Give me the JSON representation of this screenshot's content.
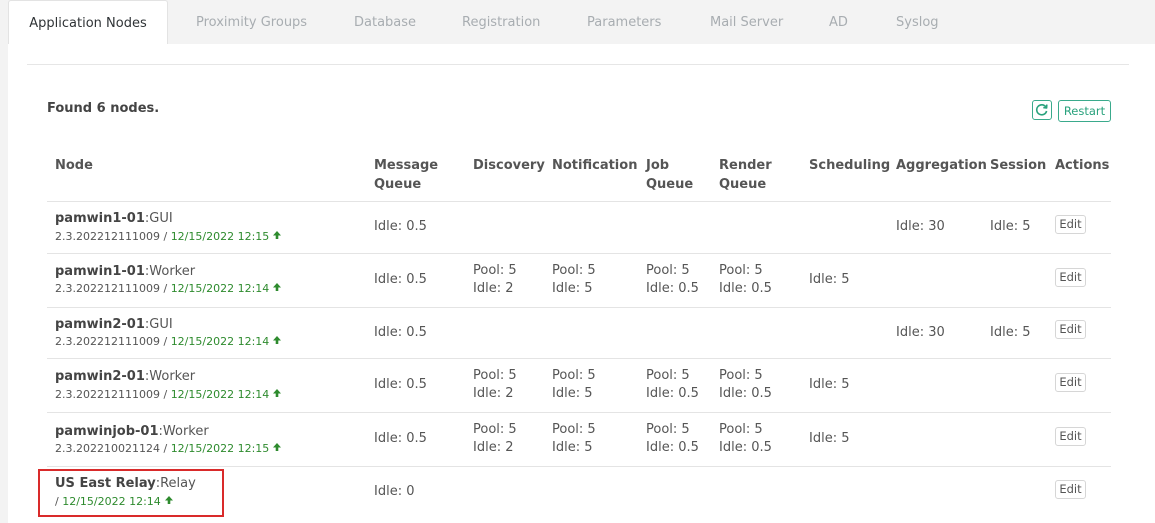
{
  "tabs": [
    {
      "label": "Application Nodes",
      "active": true
    },
    {
      "label": "Proximity Groups"
    },
    {
      "label": "Database"
    },
    {
      "label": "Registration"
    },
    {
      "label": "Parameters"
    },
    {
      "label": "Mail Server"
    },
    {
      "label": "AD"
    },
    {
      "label": "Syslog"
    }
  ],
  "summary": {
    "found_text": "Found 6 nodes."
  },
  "toolbar": {
    "refresh_icon": "refresh-icon",
    "restart_label": "Restart"
  },
  "table": {
    "headers": {
      "node": "Node",
      "message_queue_1": "Message",
      "message_queue_2": "Queue",
      "discovery": "Discovery",
      "notification": "Notification",
      "job_queue_1": "Job",
      "job_queue_2": "Queue",
      "render_queue_1": "Render",
      "render_queue_2": "Queue",
      "scheduling": "Scheduling",
      "aggregation": "Aggregation",
      "session": "Session",
      "actions": "Actions"
    },
    "rows": [
      {
        "name": "pamwin1-01",
        "type": ":GUI",
        "version": "2.3.202212111009",
        "sep": " / ",
        "date": "12/15/2022 12:15",
        "message_queue": "Idle: 0.5",
        "aggregation": "Idle: 30",
        "session": "Idle: 5",
        "edit_label": "Edit"
      },
      {
        "name": "pamwin1-01",
        "type": ":Worker",
        "version": "2.3.202212111009",
        "sep": " / ",
        "date": "12/15/2022 12:14",
        "message_queue": "Idle: 0.5",
        "discovery_1": "Pool: 5",
        "discovery_2": "Idle: 2",
        "notification_1": "Pool: 5",
        "notification_2": "Idle: 5",
        "job_1": "Pool: 5",
        "job_2": "Idle: 0.5",
        "render_1": "Pool: 5",
        "render_2": "Idle: 0.5",
        "scheduling": "Idle: 5",
        "edit_label": "Edit"
      },
      {
        "name": "pamwin2-01",
        "type": ":GUI",
        "version": "2.3.202212111009",
        "sep": " / ",
        "date": "12/15/2022 12:14",
        "message_queue": "Idle: 0.5",
        "aggregation": "Idle: 30",
        "session": "Idle: 5",
        "edit_label": "Edit"
      },
      {
        "name": "pamwin2-01",
        "type": ":Worker",
        "version": "2.3.202212111009",
        "sep": " / ",
        "date": "12/15/2022 12:14",
        "message_queue": "Idle: 0.5",
        "discovery_1": "Pool: 5",
        "discovery_2": "Idle: 2",
        "notification_1": "Pool: 5",
        "notification_2": "Idle: 5",
        "job_1": "Pool: 5",
        "job_2": "Idle: 0.5",
        "render_1": "Pool: 5",
        "render_2": "Idle: 0.5",
        "scheduling": "Idle: 5",
        "edit_label": "Edit"
      },
      {
        "name": "pamwinjob-01",
        "type": ":Worker",
        "version": "2.3.202210021124",
        "sep": " / ",
        "date": "12/15/2022 12:15",
        "message_queue": "Idle: 0.5",
        "discovery_1": "Pool: 5",
        "discovery_2": "Idle: 2",
        "notification_1": "Pool: 5",
        "notification_2": "Idle: 5",
        "job_1": "Pool: 5",
        "job_2": "Idle: 0.5",
        "render_1": "Pool: 5",
        "render_2": "Idle: 0.5",
        "scheduling": "Idle: 5",
        "edit_label": "Edit"
      },
      {
        "name": "US East Relay",
        "type": ":Relay",
        "version": "",
        "sep": "/ ",
        "date": "12/15/2022 12:14",
        "message_queue": "Idle: 0",
        "edit_label": "Edit"
      }
    ]
  },
  "colors": {
    "accent": "#2aa27d",
    "date_green": "#2e8b2e",
    "highlight": "#d92a2a"
  },
  "icons": {
    "status": "arrow-up-icon"
  }
}
